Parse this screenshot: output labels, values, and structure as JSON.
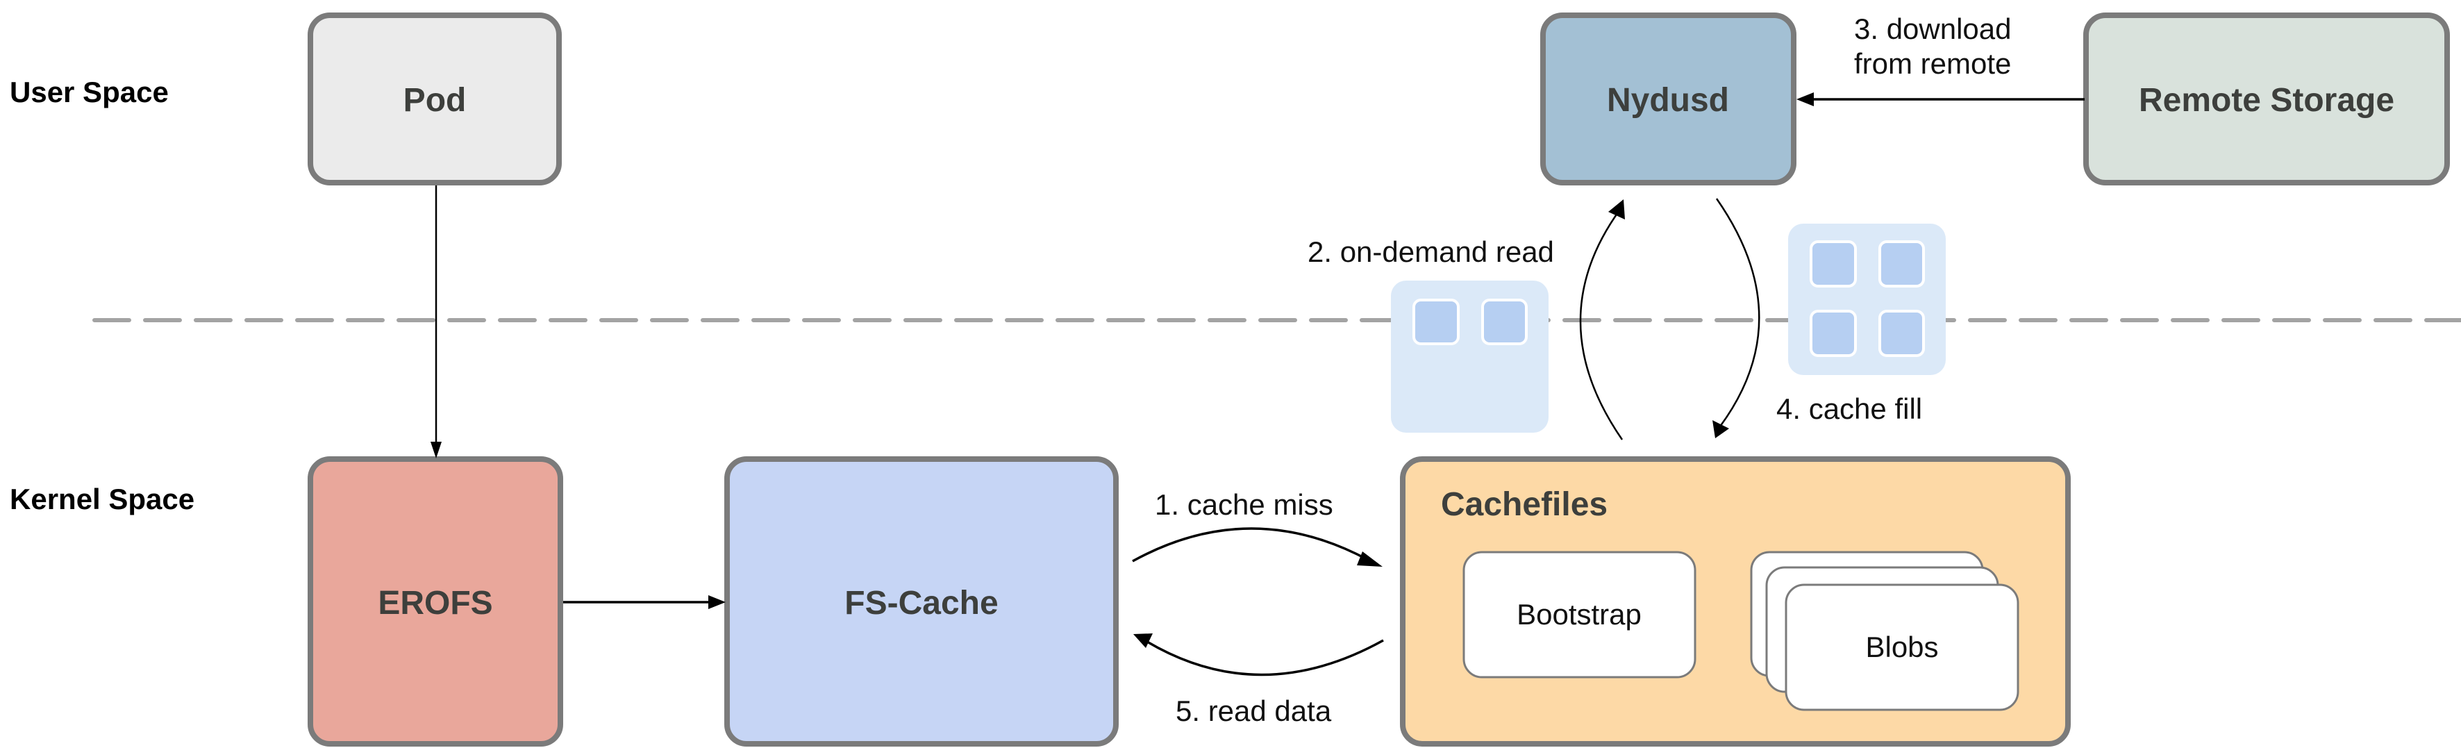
{
  "zones": {
    "user_space": "User Space",
    "kernel_space": "Kernel Space"
  },
  "nodes": {
    "pod": {
      "label": "Pod",
      "fill": "#ebebeb"
    },
    "erofs": {
      "label": "EROFS",
      "fill": "#e9a79b"
    },
    "fscache": {
      "label": "FS-Cache",
      "fill": "#c6d5f5"
    },
    "cachefiles": {
      "label": "Cachefiles",
      "fill": "#fdd9a6",
      "children": {
        "bootstrap": "Bootstrap",
        "blobs": "Blobs"
      }
    },
    "nydusd": {
      "label": "Nydusd",
      "fill": "#a3c0d4"
    },
    "remote_storage": {
      "label": "Remote Storage",
      "fill": "#d9e2dc"
    }
  },
  "edges": {
    "cache_miss": "1. cache miss",
    "on_demand_read": "2. on-demand read",
    "download_line1": "3. download",
    "download_line2": "from remote",
    "cache_fill": "4. cache fill",
    "read_data": "5. read data"
  },
  "data_blocks": {
    "on_demand_read_cells": 2,
    "cache_fill_cells": 4
  },
  "colors": {
    "border": "#7b7b7b",
    "label_text": "#3d3f3c",
    "divider": "#a3a3a3",
    "block_bg": "#dbe9f8",
    "block_cell": "#b6cff2"
  }
}
